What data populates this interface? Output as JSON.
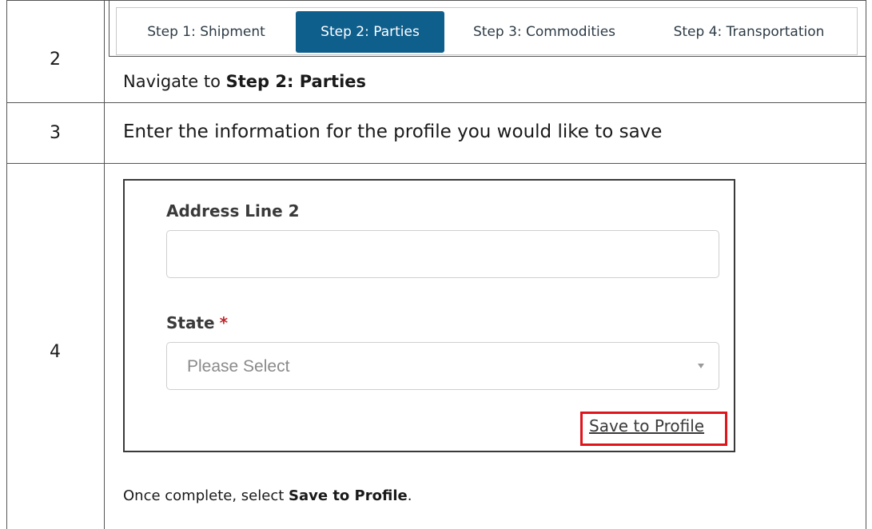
{
  "rows": {
    "row2": {
      "number": "2",
      "instruction_prefix": "Navigate to ",
      "instruction_bold": "Step 2: Parties"
    },
    "row3": {
      "number": "3",
      "instruction": "Enter the information for the profile you would like to save"
    },
    "row4": {
      "number": "4",
      "note_prefix": "Once complete, select ",
      "note_bold": "Save to Profile",
      "note_suffix": "."
    }
  },
  "tabs": [
    {
      "label": "Step 1: Shipment",
      "active": false
    },
    {
      "label": "Step 2: Parties",
      "active": true
    },
    {
      "label": "Step 3: Commodities",
      "active": false
    },
    {
      "label": "Step 4: Transportation",
      "active": false
    }
  ],
  "form": {
    "address_line2": {
      "label": "Address Line 2",
      "value": "",
      "placeholder": ""
    },
    "state": {
      "label": "State",
      "required_marker": "*",
      "selected": "Please Select"
    },
    "save_link": "Save to Profile"
  },
  "colors": {
    "active_tab": "#0f5f8d",
    "highlight_box": "#e0141b",
    "required": "#c0272d"
  }
}
